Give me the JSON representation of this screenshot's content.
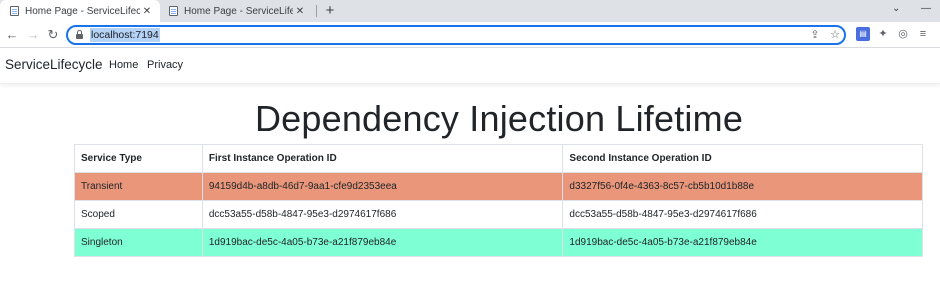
{
  "browser": {
    "tabs": [
      {
        "title": "Home Page - ServiceLifecycle",
        "active": true,
        "favicon": "page-icon",
        "close_icon": "✕"
      },
      {
        "title": "Home Page - ServiceLifecycle",
        "active": false,
        "favicon": "page-icon",
        "close_icon": "✕"
      }
    ],
    "new_tab_icon": "+",
    "tab_menu_icon": "⌄",
    "minimize_icon": "—",
    "back_icon": "←",
    "forward_icon": "→",
    "reload_icon": "↻",
    "url": "localhost:7194",
    "share_icon": "⇪",
    "bookmark_icon": "☆",
    "extension_icons": [
      "▤",
      "✦",
      "◎",
      "≡"
    ],
    "focus_color": "#1a73e8"
  },
  "app_nav": {
    "brand": "ServiceLifecycle",
    "links": [
      "Home",
      "Privacy"
    ]
  },
  "main": {
    "heading": "Dependency Injection Lifetime",
    "table": {
      "headers": [
        "Service Type",
        "First Instance Operation ID",
        "Second Instance Operation ID"
      ],
      "rows": [
        {
          "type": "Transient",
          "first": "94159d4b-a8db-46d7-9aa1-cfe9d2353eea",
          "second": "d3327f56-0f4e-4363-8c57-cb5b10d1b88e",
          "color": "#e9967a"
        },
        {
          "type": "Scoped",
          "first": "dcc53a55-d58b-4847-95e3-d2974617f686",
          "second": "dcc53a55-d58b-4847-95e3-d2974617f686",
          "color": "#ffffff"
        },
        {
          "type": "Singleton",
          "first": "1d919bac-de5c-4a05-b73e-a21f879eb84e",
          "second": "1d919bac-de5c-4a05-b73e-a21f879eb84e",
          "color": "#7fffd4"
        }
      ]
    }
  }
}
